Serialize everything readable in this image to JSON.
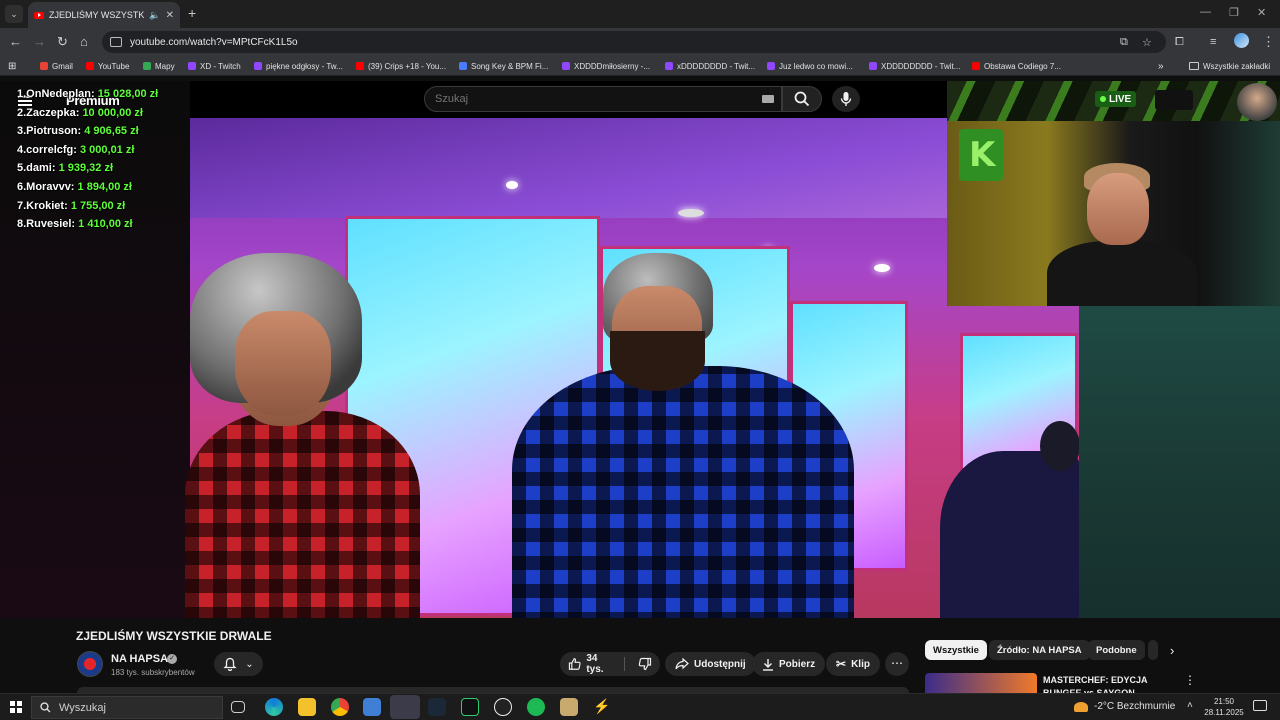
{
  "browser": {
    "tab_title": "ZJEDLIŚMY WSZYSTKIE DRWALE",
    "url": "youtube.com/watch?v=MPtCFcK1L5o",
    "bookmarks": [
      {
        "label": "Gmail",
        "icon": "gmail-icon",
        "color": "#ea4335"
      },
      {
        "label": "YouTube",
        "icon": "youtube-icon",
        "color": "#ff0000"
      },
      {
        "label": "Mapy",
        "icon": "maps-icon",
        "color": "#34a853"
      },
      {
        "label": "XD - Twitch",
        "icon": "twitch-icon",
        "color": "#9146ff"
      },
      {
        "label": "piękne odgłosy - Tw...",
        "icon": "twitch-icon",
        "color": "#9146ff"
      },
      {
        "label": "(39) Crips +18 - You...",
        "icon": "youtube-icon",
        "color": "#ff0000"
      },
      {
        "label": "Song Key & BPM Fi...",
        "icon": "music-icon",
        "color": "#4a7cff"
      },
      {
        "label": "XDDDDmiłosierny -...",
        "icon": "twitch-icon",
        "color": "#9146ff"
      },
      {
        "label": "xDDDDDDDD - Twit...",
        "icon": "twitch-icon",
        "color": "#9146ff"
      },
      {
        "label": "Juz ledwo co mowi...",
        "icon": "twitch-icon",
        "color": "#9146ff"
      },
      {
        "label": "XDDDDDDDD - Twit...",
        "icon": "twitch-icon",
        "color": "#9146ff"
      },
      {
        "label": "Obstawa Codiego 7...",
        "icon": "youtube-icon",
        "color": "#ff0000"
      }
    ],
    "all_bookmarks": "Wszystkie zakładki"
  },
  "youtube": {
    "logo_text": "Premium",
    "search_placeholder": "Szukaj",
    "leaderboard": [
      {
        "name": "1.OnNedeplan:",
        "amount": "15 028,00 zł"
      },
      {
        "name": "2.Zaczepka:",
        "amount": "10 000,00 zł"
      },
      {
        "name": "3.Piotruson:",
        "amount": "4 906,65 zł"
      },
      {
        "name": "4.correlcfg:",
        "amount": "3 000,01 zł"
      },
      {
        "name": "5.dami:",
        "amount": "1 939,32 zł"
      },
      {
        "name": "6.Moravvv:",
        "amount": "1 894,00 zł"
      },
      {
        "name": "7.Krokiet:",
        "amount": "1 755,00 zł"
      },
      {
        "name": "8.Ruvesiel:",
        "amount": "1 410,00 zł"
      }
    ],
    "cam_live_label": "LIVE",
    "video_title": "ZJEDLIŚMY WSZYSTKIE DRWALE",
    "channel_name": "NA HAPSA",
    "subscribers": "183 tys. subskrybentów",
    "likes": "34 tys.",
    "share_label": "Udostępnij",
    "download_label": "Pobierz",
    "clip_label": "Klip",
    "chips": [
      "Wszystkie",
      "Źródło: NA HAPSA",
      "Podobne"
    ],
    "recommended_title": "MASTERCHEF: EDYCJA BUNGEE vs SAYGON"
  },
  "taskbar": {
    "search_label": "Wyszukaj",
    "weather": "-2°C  Bezchmurnie",
    "time": "21:50",
    "date": "28.11.2025"
  }
}
